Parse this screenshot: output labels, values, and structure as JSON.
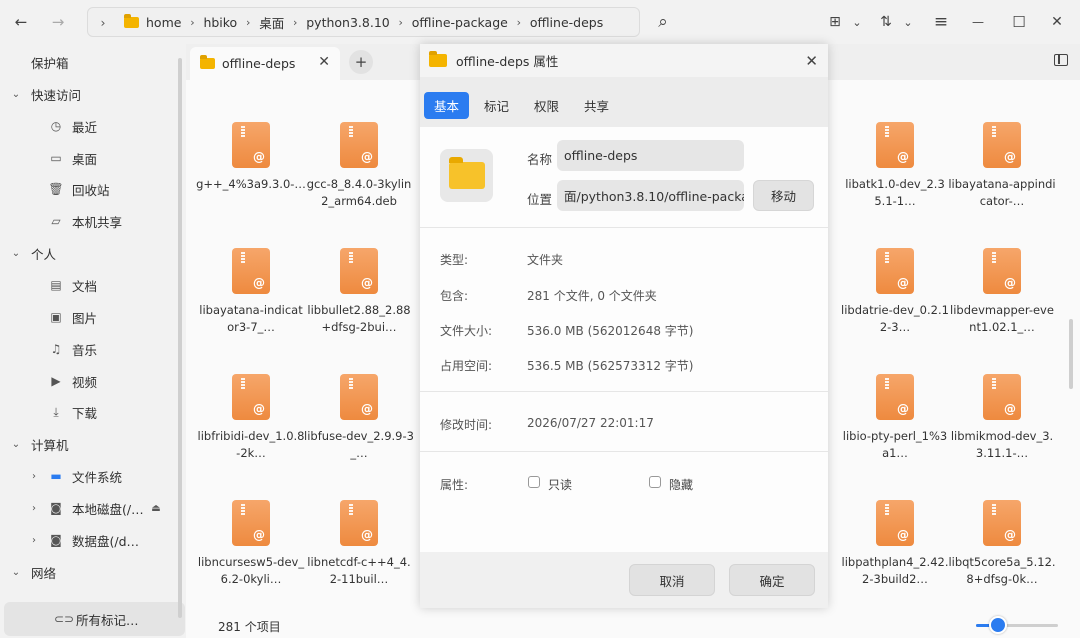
{
  "topbar": {
    "back_icon": "←",
    "forward_icon": "→",
    "crumb_chevron": "›",
    "breadcrumb": [
      "home",
      "hbiko",
      "桌面",
      "python3.8.10",
      "offline-package",
      "offline-deps"
    ],
    "search_icon": "⌕",
    "view_grid_icon": "⊞",
    "sort_icon": "⇅",
    "menu_icon": "≡",
    "minimize_icon": "—",
    "maximize_icon": "☐",
    "close_icon": "✕"
  },
  "sidebar": {
    "vault": "保护箱",
    "quick_access": "快速访问",
    "recent": "最近",
    "desktop": "桌面",
    "trash": "回收站",
    "local_share": "本机共享",
    "personal": "个人",
    "documents": "文档",
    "pictures": "图片",
    "music": "音乐",
    "videos": "视频",
    "downloads": "下载",
    "computer": "计算机",
    "filesystem": "文件系统",
    "local_disk": "本地磁盘(/…",
    "data_disk": "数据盘(/d…",
    "network": "网络",
    "all_tags": "所有标记…"
  },
  "tabbar": {
    "tab_label": "offline-deps",
    "add": "+"
  },
  "files": [
    "g++_4%3a9.3.0-…",
    "gcc-8_8.4.0-3kylin2_arm64.deb",
    "libatk1.0-dev_2.35.1-1…",
    "libayatana-appindicator-…",
    "libayatana-indicator3-7_…",
    "libbullet2.88_2.88+dfsg-2bui…",
    "libdatrie-dev_0.2.12-3…",
    "libdevmapper-event1.02.1_…",
    "libfribidi-dev_1.0.8-2k…",
    "libfuse-dev_2.9.9-3_…",
    "libio-pty-perl_1%3a1…",
    "libmikmod-dev_3.3.11.1-…",
    "libncursesw5-dev_6.2-0kyli…",
    "libnetcdf-c++4_4.2-11buil…",
    "libpathplan4_2.42.2-3build2…",
    "libqt5core5a_5.12.8+dfsg-0k…"
  ],
  "status": {
    "count": "281 个项目",
    "zoom_level": 0.27
  },
  "dialog": {
    "title": "offline-deps 属性",
    "tabs": [
      "基本",
      "标记",
      "权限",
      "共享"
    ],
    "name_label": "名称",
    "name_value": "offline-deps",
    "location_label": "位置",
    "location_value": "面/python3.8.10/offline-package",
    "move_button": "移动",
    "type_key": "类型:",
    "type_value": "文件夹",
    "contains_key": "包含:",
    "contains_value": "281 个文件, 0 个文件夹",
    "size_key": "文件大小:",
    "size_value": "536.0 MB (562012648 字节)",
    "disk_key": "占用空间:",
    "disk_value": "536.5 MB (562573312 字节)",
    "modified_key": "修改时间:",
    "modified_value": "2026/07/27 22:01:17",
    "attrs_key": "属性:",
    "readonly": "只读",
    "hidden": "隐藏",
    "cancel": "取消",
    "ok": "确定"
  }
}
